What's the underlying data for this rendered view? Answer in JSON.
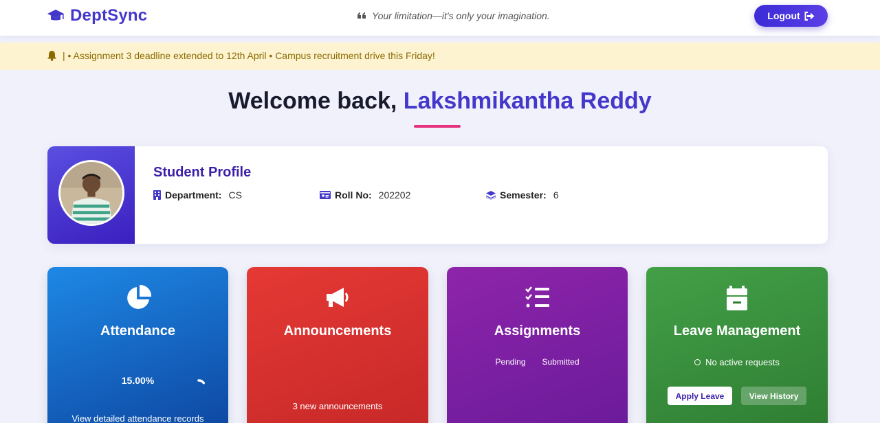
{
  "header": {
    "brand": "DeptSync",
    "quote": "Your limitation—it's only your imagination.",
    "logout_label": "Logout"
  },
  "notice": {
    "text": "| • Assignment 3 deadline extended to 12th April • Campus recruitment drive this Friday!"
  },
  "welcome": {
    "prefix": "Welcome back, ",
    "name": "Lakshmikantha Reddy"
  },
  "profile": {
    "title": "Student Profile",
    "department_label": "Department:",
    "department": "CS",
    "roll_label": "Roll No:",
    "roll": "202202",
    "semester_label": "Semester:",
    "semester": "6"
  },
  "cards": {
    "attendance": {
      "title": "Attendance",
      "percent": "15.00%",
      "percent_value": 0.15,
      "link": "View detailed attendance records",
      "icon": "pie-chart-icon"
    },
    "announcements": {
      "title": "Announcements",
      "count_text": "3 new announcements",
      "icon": "megaphone-icon"
    },
    "assignments": {
      "title": "Assignments",
      "tab_pending": "Pending",
      "tab_submitted": "Submitted",
      "icon": "list-check-icon"
    },
    "leave": {
      "title": "Leave Management",
      "status": "No active requests",
      "apply_label": "Apply Leave",
      "history_label": "View History",
      "icon": "calendar-icon"
    }
  },
  "colors": {
    "brand": "#4338ca",
    "accent_underline": "#e6337f",
    "attendance": "#1e88e5",
    "announcements": "#e53935",
    "assignments": "#8e24aa",
    "leave": "#43a047"
  }
}
